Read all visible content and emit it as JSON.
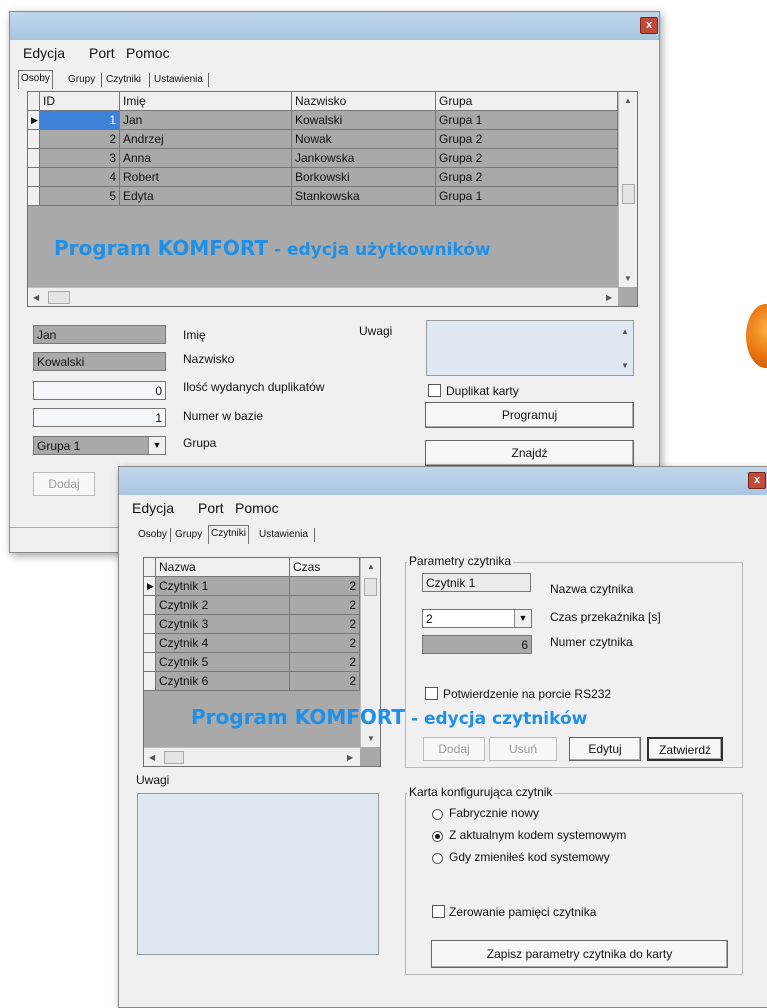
{
  "window1": {
    "menu": [
      "Edycja",
      "Port",
      "Pomoc"
    ],
    "tabs": [
      "Osoby",
      "Grupy",
      "Czytniki",
      "Ustawienia"
    ],
    "close_glyph": "x",
    "table": {
      "columns": [
        "ID",
        "Imię",
        "Nazwisko",
        "Grupa"
      ],
      "rows": [
        {
          "id": "1",
          "imie": "Jan",
          "nazwisko": "Kowalski",
          "grupa": "Grupa 1"
        },
        {
          "id": "2",
          "imie": "Andrzej",
          "nazwisko": "Nowak",
          "grupa": "Grupa 2"
        },
        {
          "id": "3",
          "imie": "Anna",
          "nazwisko": "Jankowska",
          "grupa": "Grupa 2"
        },
        {
          "id": "4",
          "imie": "Robert",
          "nazwisko": "Borkowski",
          "grupa": "Grupa 2"
        },
        {
          "id": "5",
          "imie": "Edyta",
          "nazwisko": "Stankowska",
          "grupa": "Grupa 1"
        }
      ]
    },
    "overlay": {
      "part1": "Program KOMFORT",
      "part2": " - edycja użytkowników"
    },
    "form": {
      "imie_value": "Jan",
      "imie_label": "Imię",
      "nazwisko_value": "Kowalski",
      "nazwisko_label": "Nazwisko",
      "duplikaty_value": "0",
      "duplikaty_label": "Ilość wydanych duplikatów",
      "numer_value": "1",
      "numer_label": "Numer w bazie",
      "grupa_value": "Grupa 1",
      "grupa_label": "Grupa",
      "uwagi_label": "Uwagi",
      "duplikat_label": "Duplikat karty",
      "programuj_label": "Programuj",
      "znajdz_label": "Znajdź",
      "dodaj_label": "Dodaj"
    }
  },
  "window2": {
    "menu": [
      "Edycja",
      "Port",
      "Pomoc"
    ],
    "tabs": [
      "Osoby",
      "Grupy",
      "Czytniki",
      "Ustawienia"
    ],
    "close_glyph": "x",
    "table": {
      "columns": [
        "Nazwa",
        "Czas"
      ],
      "rows": [
        {
          "nazwa": "Czytnik 1",
          "czas": "2"
        },
        {
          "nazwa": "Czytnik 2",
          "czas": "2"
        },
        {
          "nazwa": "Czytnik 3",
          "czas": "2"
        },
        {
          "nazwa": "Czytnik 4",
          "czas": "2"
        },
        {
          "nazwa": "Czytnik 5",
          "czas": "2"
        },
        {
          "nazwa": "Czytnik 6",
          "czas": "2"
        }
      ]
    },
    "uwagi_label": "Uwagi",
    "overlay": {
      "part1": "Program KOMFORT",
      "part2": " - edycja czytników"
    },
    "params": {
      "group_title": "Parametry czytnika",
      "nazwa_value": "Czytnik 1",
      "nazwa_label": "Nazwa czytnika",
      "czas_value": "2",
      "czas_label": "Czas przekaźnika [s]",
      "numer_value": "6",
      "numer_label": "Numer czytnika",
      "rs232_label": "Potwierdzenie na porcie RS232",
      "buttons": [
        "Dodaj",
        "Usuń",
        "Edytuj",
        "Zatwierdź"
      ]
    },
    "karta": {
      "group_title": "Karta konfigurująca czytnik",
      "options": [
        "Fabrycznie nowy",
        "Z aktualnym kodem systemowym",
        "Gdy zmieniłeś kod systemowy"
      ],
      "selected": "Z aktualnym kodem systemowym",
      "zerowanie_label": "Zerowanie pamięci czytnika",
      "zapisz_label": "Zapisz parametry czytnika do karty"
    }
  },
  "colors": {
    "accent": "#1e90e8",
    "grid": "#a9a9a9",
    "selection": "#3d82d8",
    "orange_logo": "#e8740f"
  }
}
